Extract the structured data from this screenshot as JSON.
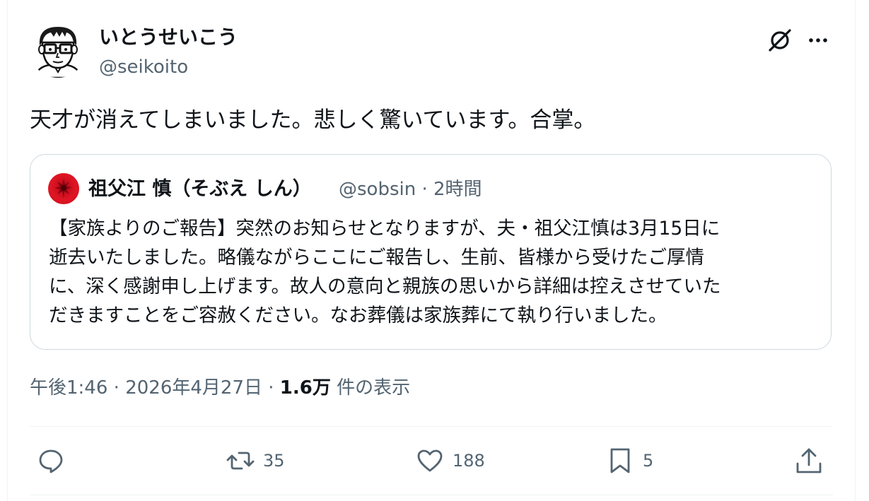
{
  "author": {
    "display_name": "いとうせいこう",
    "handle": "@seikoito"
  },
  "tweet": {
    "text": "天才が消えてしまいました。悲しく驚いています。合掌。"
  },
  "quote": {
    "display_name": "祖父江 慎（そぶえ しん）",
    "handle": "@sobsin",
    "separator": "·",
    "time": "2時間",
    "lines": [
      "【家族よりのご報告】突然のお知らせとなりますが、夫・祖父江慎は3月15日に",
      "逝去いたしました。略儀ながらここにご報告し、生前、皆様から受けたご厚情",
      "に、深く感謝申し上げます。故人の意向と親族の思いから詳細は控えさせていた",
      "だきますことをご容赦ください。なお葬儀は家族葬にて執り行いました。"
    ]
  },
  "meta": {
    "time": "午後1:46",
    "sep1": "·",
    "date": "2026年4月27日",
    "sep2": "·",
    "views_count": "1.6万",
    "views_label": "件の表示"
  },
  "actions": {
    "reply_count": "",
    "repost_count": "35",
    "like_count": "188",
    "bookmark_count": "5"
  },
  "icons": {
    "grok": "grok-icon",
    "more": "more-icon",
    "reply": "reply-icon",
    "repost": "repost-icon",
    "like": "like-icon",
    "bookmark": "bookmark-icon",
    "share": "share-icon"
  },
  "colors": {
    "text": "#0f1419",
    "secondary": "#536471",
    "border": "#cfd9de",
    "quote_avatar": "#e01524"
  }
}
